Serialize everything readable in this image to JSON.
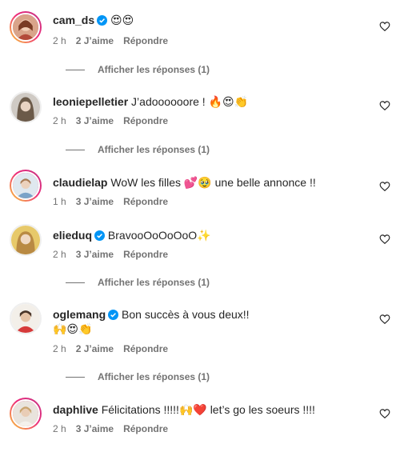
{
  "comments": [
    {
      "username": "cam_ds",
      "verified": true,
      "text": "😍😍",
      "time": "2 h",
      "likes": "2 J’aime",
      "reply": "Répondre",
      "replies": "Afficher les réponses (1)"
    },
    {
      "username": "leoniepelletier",
      "verified": false,
      "text": "J’adoooooore ! 🔥😍👏",
      "time": "2 h",
      "likes": "3 J’aime",
      "reply": "Répondre",
      "replies": "Afficher les réponses (1)"
    },
    {
      "username": "claudielap",
      "verified": false,
      "text": "WoW les filles 💕🥹 une belle annonce !!",
      "time": "1 h",
      "likes": "3 J’aime",
      "reply": "Répondre"
    },
    {
      "username": "elieduq",
      "verified": true,
      "text": "BravooOoOoOoO✨",
      "time": "2 h",
      "likes": "3 J’aime",
      "reply": "Répondre",
      "replies": "Afficher les réponses (1)"
    },
    {
      "username": "oglemang",
      "verified": true,
      "text": "Bon succès à vous deux!!",
      "text2": "🙌😍👏",
      "time": "2 h",
      "likes": "2 J’aime",
      "reply": "Répondre",
      "replies": "Afficher les réponses (1)"
    },
    {
      "username": "daphlive",
      "verified": false,
      "text": "Félicitations !!!!!🙌❤️ let’s go les soeurs !!!!",
      "time": "2 h",
      "likes": "3 J’aime",
      "reply": "Répondre"
    }
  ],
  "colors": {
    "text": "#262626",
    "secondary": "#737373",
    "verified": "#0095f6",
    "story_ring_start": "#f9ce34",
    "story_ring_end": "#c13584"
  },
  "icons": {
    "like": "heart-outline-icon",
    "verified": "verified-badge-icon"
  }
}
